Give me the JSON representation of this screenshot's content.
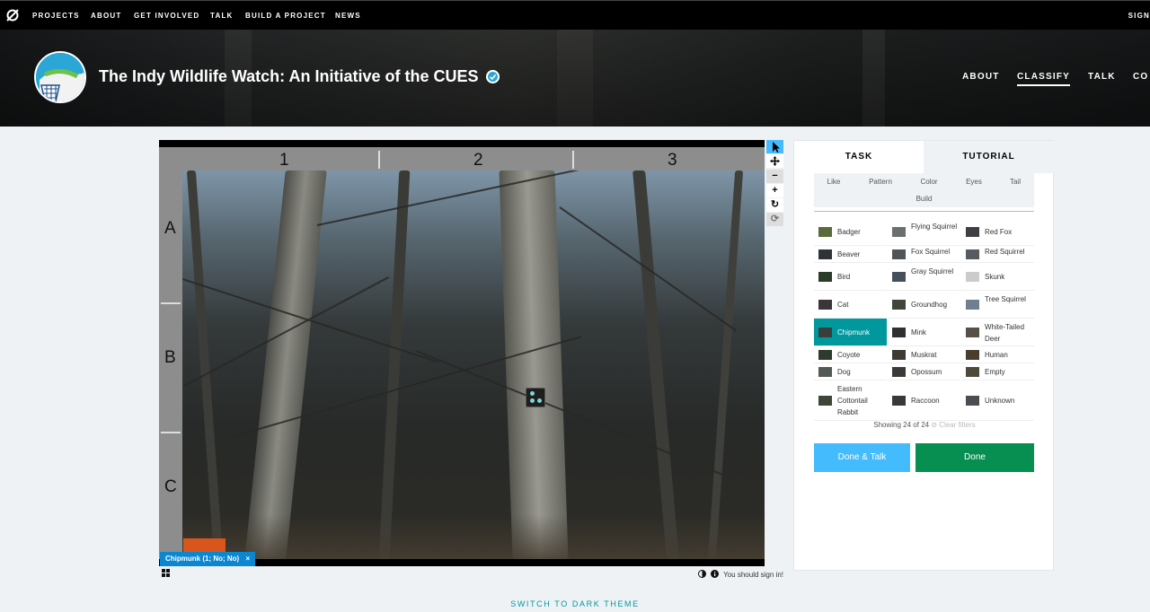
{
  "topnav": {
    "logo_icon": "zooniverse-logo-icon",
    "items": [
      "PROJECTS",
      "ABOUT",
      "GET INVOLVED",
      "TALK",
      "BUILD A PROJECT",
      "NEWS"
    ],
    "signin": "SIGN"
  },
  "project": {
    "title": "The Indy Wildlife Watch: An Initiative of the CUES",
    "verified_icon": "check-badge-icon",
    "nav": [
      "ABOUT",
      "CLASSIFY",
      "TALK",
      "CO"
    ],
    "active_nav": "CLASSIFY"
  },
  "viewer": {
    "columns": [
      "1",
      "2",
      "3"
    ],
    "rows": [
      "A",
      "B",
      "C"
    ],
    "tools": [
      "pointer-icon",
      "move-icon",
      "zoom-out-icon",
      "zoom-in-icon",
      "rotate-icon",
      "reset-icon"
    ],
    "mark_label": "Chipmunk (1; No; No)",
    "mark_close": "×",
    "footer_note": "You should sign in!",
    "footer_icons": [
      "contrast-icon",
      "info-icon"
    ],
    "grid_icon": "grid-icon"
  },
  "task_panel": {
    "tabs": [
      "TASK",
      "TUTORIAL"
    ],
    "active_tab": "TASK",
    "filters": [
      "Like",
      "Pattern",
      "Color",
      "Eyes",
      "Tail",
      "Build"
    ],
    "choices": [
      {
        "label": "Badger",
        "col": 0
      },
      {
        "label": "Flying Squirrel",
        "col": 1
      },
      {
        "label": "Red Fox",
        "col": 2
      },
      {
        "label": "Beaver",
        "col": 0
      },
      {
        "label": "Fox Squirrel",
        "col": 1
      },
      {
        "label": "Red Squirrel",
        "col": 2
      },
      {
        "label": "Bird",
        "col": 0
      },
      {
        "label": "Gray Squirrel",
        "col": 1
      },
      {
        "label": "Skunk",
        "col": 2
      },
      {
        "label": "Cat",
        "col": 0
      },
      {
        "label": "Groundhog",
        "col": 1
      },
      {
        "label": "Tree Squirrel",
        "col": 2
      },
      {
        "label": "Chipmunk",
        "col": 0,
        "selected": true
      },
      {
        "label": "Mink",
        "col": 1
      },
      {
        "label": "White-Tailed Deer",
        "col": 2
      },
      {
        "label": "Coyote",
        "col": 0
      },
      {
        "label": "Muskrat",
        "col": 1
      },
      {
        "label": "Human",
        "col": 2
      },
      {
        "label": "Dog",
        "col": 0
      },
      {
        "label": "Opossum",
        "col": 1
      },
      {
        "label": "Empty",
        "col": 2
      },
      {
        "label": "Eastern Cottontail Rabbit",
        "col": 0
      },
      {
        "label": "Raccoon",
        "col": 1
      },
      {
        "label": "Unknown",
        "col": 2
      }
    ],
    "showing": "Showing 24 of 24",
    "clear_filters": "Clear filters",
    "done_talk": "Done & Talk",
    "done": "Done"
  },
  "footer": {
    "theme_toggle": "SWITCH TO DARK THEME"
  },
  "colors": {
    "accent": "#00979d",
    "done_talk": "#43bbfd",
    "done": "#078f52",
    "mark": "#0b87d2"
  }
}
